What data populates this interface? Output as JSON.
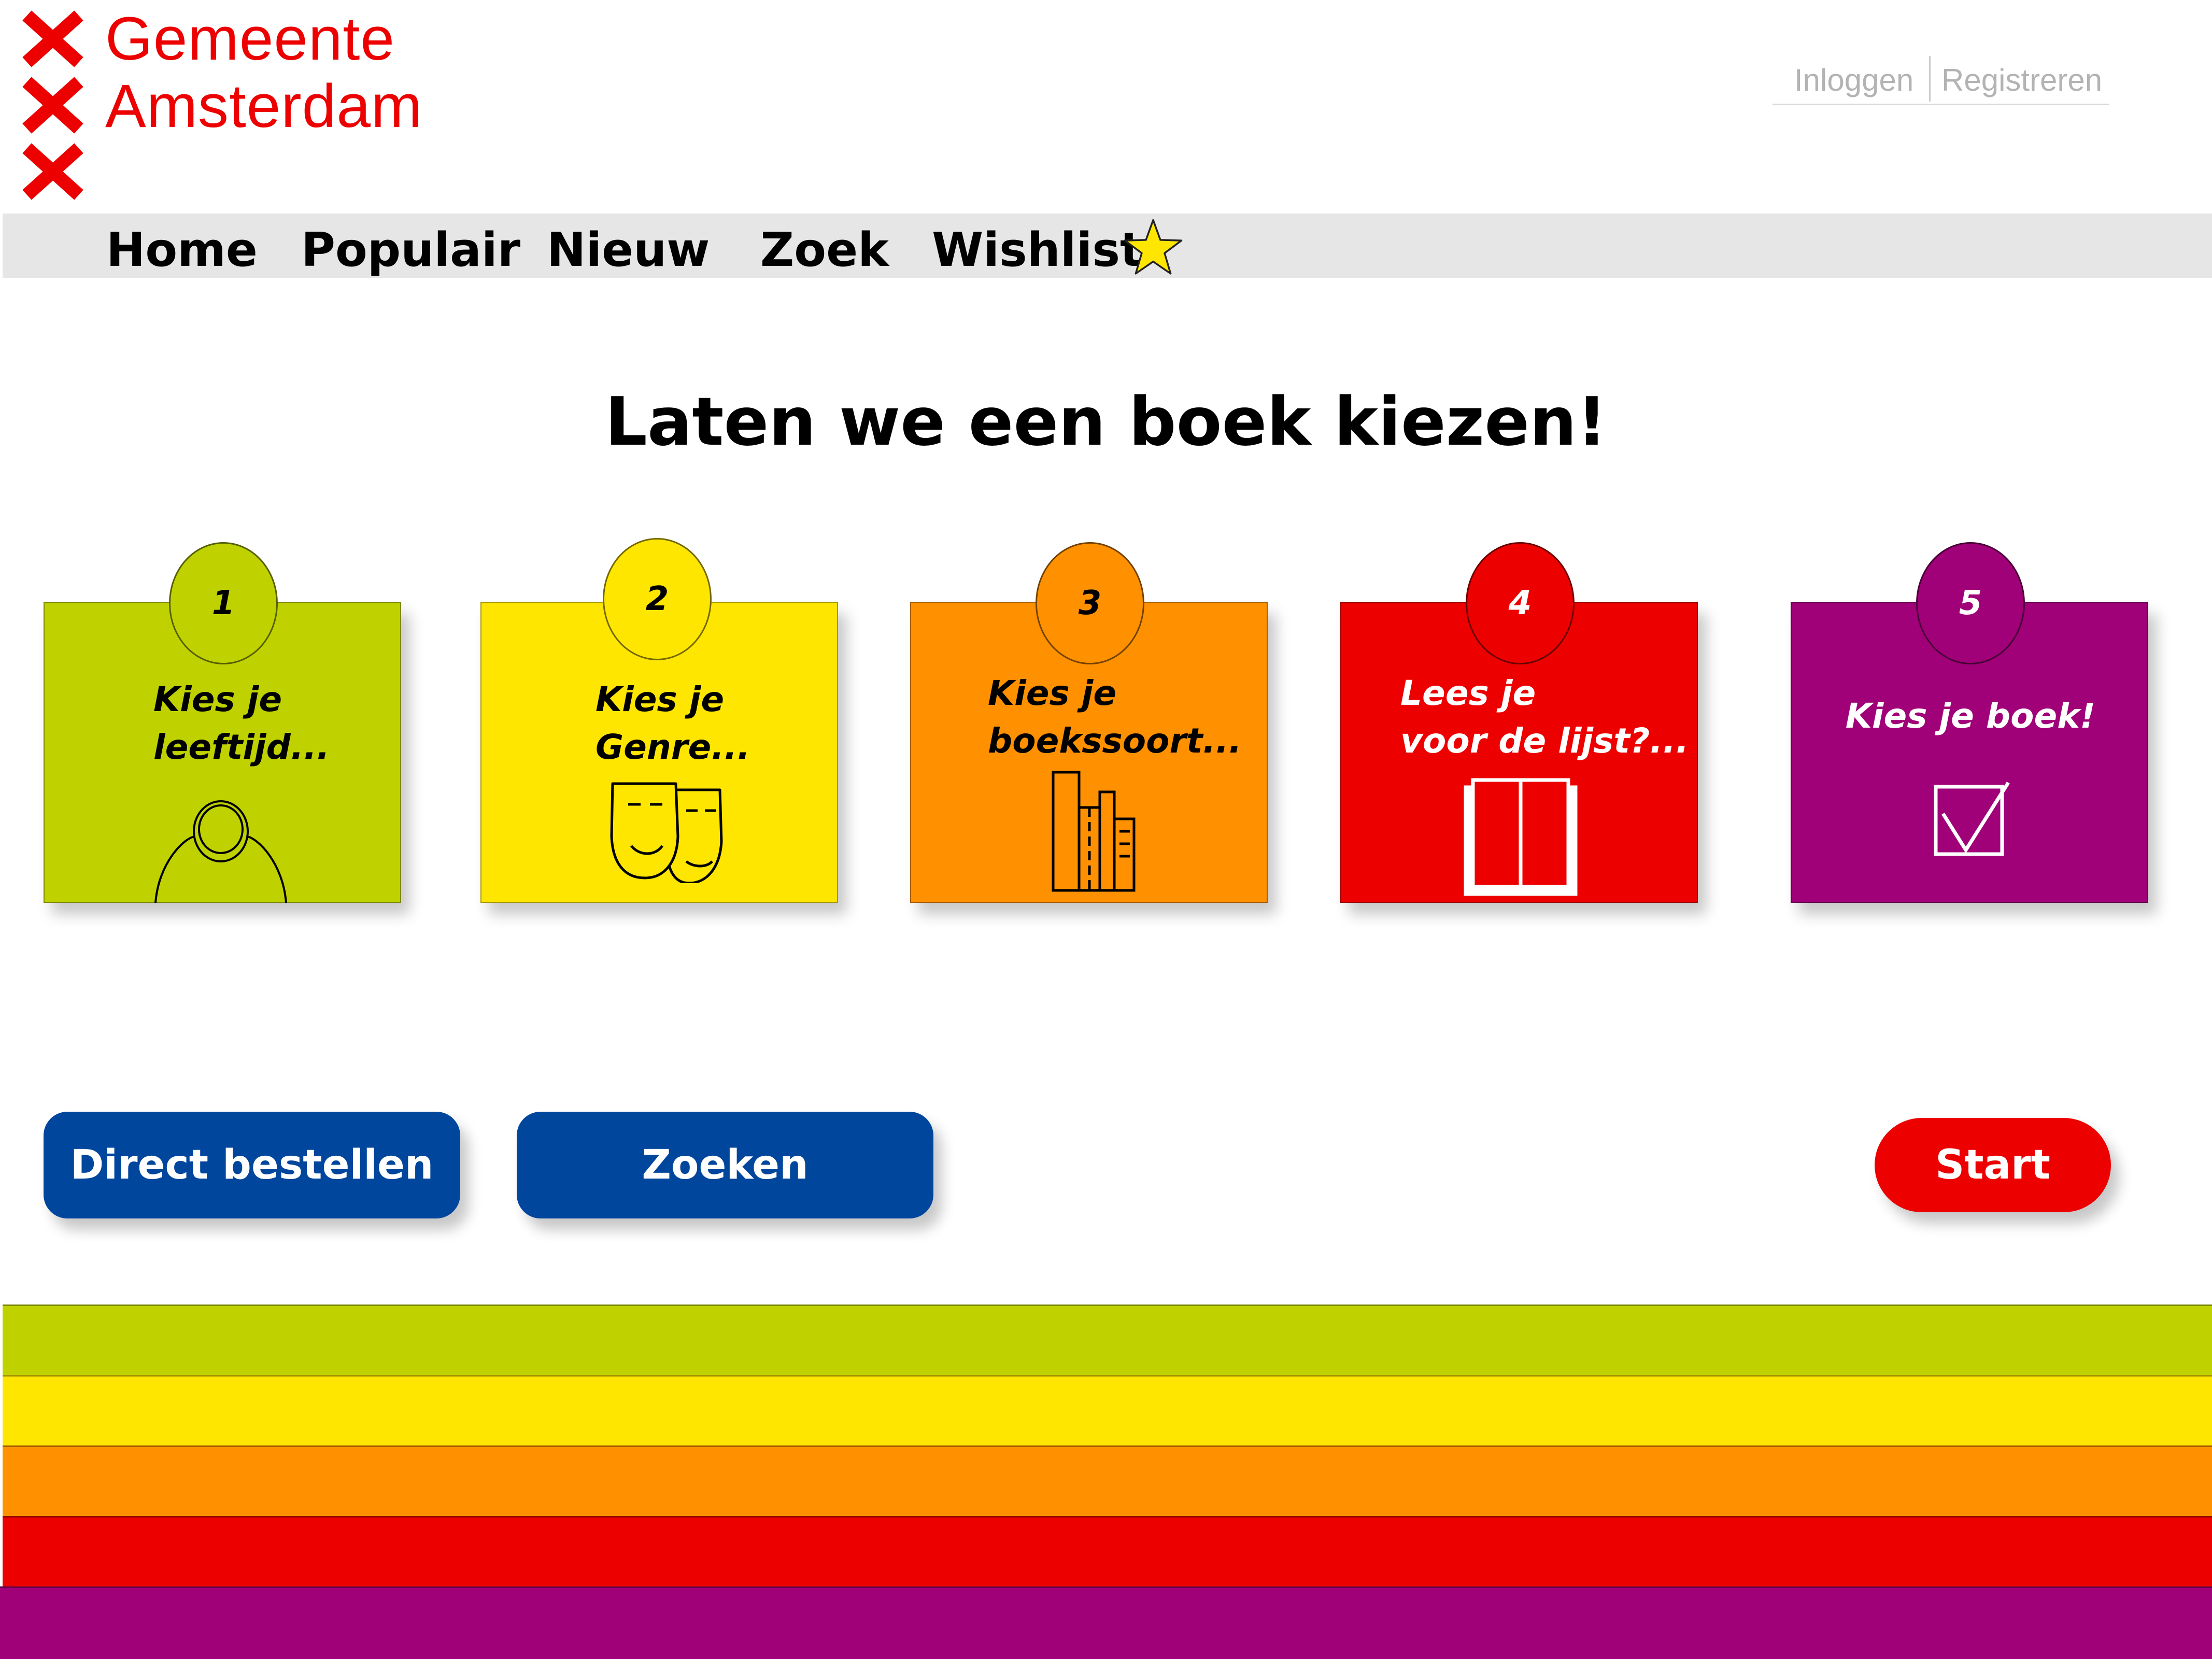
{
  "brand": {
    "line1": "Gemeente",
    "line2": "Amsterdam",
    "color": "#ec0000"
  },
  "auth": {
    "login": "Inloggen",
    "register": "Registreren"
  },
  "nav": {
    "home": "Home",
    "popular": "Populair",
    "new": "Nieuw",
    "search": "Zoek",
    "wishlist": "Wishlist",
    "wishlist_icon": "star-icon"
  },
  "main": {
    "title": "Laten we een boek kiezen!"
  },
  "steps": [
    {
      "number": "1",
      "line1": "Kies je",
      "line2": "leeftijd...",
      "color": "#bfd200",
      "icon": "person-icon"
    },
    {
      "number": "2",
      "line1": "Kies je",
      "line2": "Genre...",
      "color": "#ffe600",
      "icon": "theater-masks-icon"
    },
    {
      "number": "3",
      "line1": "Kies je",
      "line2": "boekssoort...",
      "color": "#ff9100",
      "icon": "books-icon"
    },
    {
      "number": "4",
      "line1": "Lees je",
      "line2": "voor de lijst?...",
      "color": "#ec0000",
      "icon": "open-book-icon"
    },
    {
      "number": "5",
      "line1": "Kies je boek!",
      "line2": "",
      "color": "#a00078",
      "icon": "checkbox-icon"
    }
  ],
  "buttons": {
    "order": "Direct bestellen",
    "search": "Zoeken",
    "start": "Start"
  },
  "colors": {
    "blue_button": "#00469d",
    "nav_background": "#e6e6e6",
    "stripes": [
      "#bfd200",
      "#ffe600",
      "#ff9100",
      "#ec0000",
      "#a00078"
    ]
  }
}
